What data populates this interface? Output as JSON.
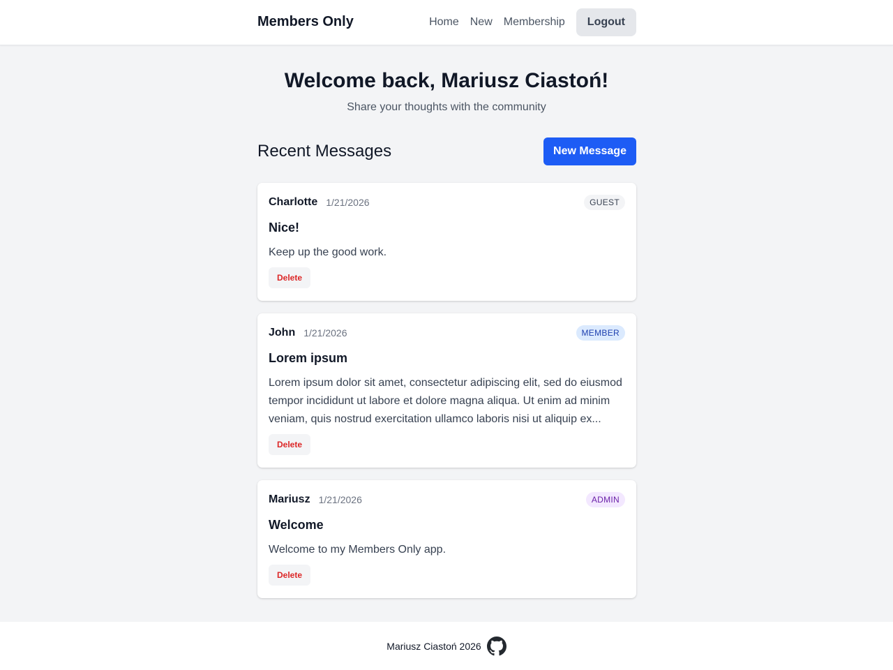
{
  "header": {
    "brand": "Members Only",
    "nav": {
      "home": "Home",
      "new": "New",
      "membership": "Membership",
      "logout": "Logout"
    }
  },
  "hero": {
    "title": "Welcome back, Mariusz Ciastoń!",
    "subtitle": "Share your thoughts with the community"
  },
  "messages_section": {
    "title": "Recent Messages",
    "new_message_label": "New Message"
  },
  "messages": [
    {
      "author": "Charlotte",
      "date": "1/21/2026",
      "role": "GUEST",
      "title": "Nice!",
      "body": "Keep up the good work.",
      "delete_label": "Delete"
    },
    {
      "author": "John",
      "date": "1/21/2026",
      "role": "MEMBER",
      "title": "Lorem ipsum",
      "body": "Lorem ipsum dolor sit amet, consectetur adipiscing elit, sed do eiusmod tempor incididunt ut labore et dolore magna aliqua. Ut enim ad minim veniam, quis nostrud exercitation ullamco laboris nisi ut aliquip ex...",
      "delete_label": "Delete"
    },
    {
      "author": "Mariusz",
      "date": "1/21/2026",
      "role": "ADMIN",
      "title": "Welcome",
      "body": "Welcome to my Members Only app.",
      "delete_label": "Delete"
    }
  ],
  "footer": {
    "text": "Mariusz Ciastoń 2026",
    "icon": "github-icon"
  },
  "colors": {
    "primary": "#1d5cf5",
    "danger": "#dc2626",
    "background": "#f3f4f6"
  }
}
